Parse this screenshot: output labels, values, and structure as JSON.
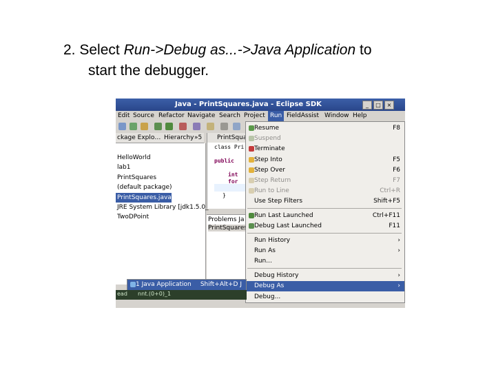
{
  "caption": {
    "line1_prefix": "2. Select ",
    "line1_emph_a": "Run->Debug as...",
    "line1_emph_b": "->Java Application",
    "line1_suffix": " to",
    "line2": "start the debugger."
  },
  "window": {
    "title": "Java - PrintSquares.java - Eclipse SDK",
    "controls": [
      "_",
      "□",
      "×"
    ]
  },
  "menubar": [
    "Edit",
    "Source",
    "Refactor",
    "Navigate",
    "Search",
    "Project",
    "Run",
    "FieldAssist",
    "Window",
    "Help"
  ],
  "left_view": {
    "tabs": [
      "ckage Explo…",
      "Hierarchy",
      "»5"
    ],
    "tree": [
      "HelloWorld",
      "lab1",
      "PrintSquares",
      "(default package)",
      "PrintSquares.java",
      "JRE System Library [jdk1.5.0_",
      "TwoDPoint"
    ]
  },
  "editor": {
    "tab_label": "PrintSqua",
    "code": [
      "class Pri",
      "public",
      "int",
      "for",
      "}"
    ]
  },
  "problems": {
    "tab": "Problems Ja",
    "row": "PrintSquares"
  },
  "run_menu": {
    "items": [
      {
        "label": "Resume",
        "accel": "F8",
        "enabled": true
      },
      {
        "label": "Suspend",
        "accel": "",
        "enabled": false
      },
      {
        "label": "Terminate",
        "accel": "",
        "enabled": true
      },
      {
        "label": "Step Into",
        "accel": "F5",
        "enabled": true
      },
      {
        "label": "Step Over",
        "accel": "F6",
        "enabled": true
      },
      {
        "label": "Step Return",
        "accel": "F7",
        "enabled": false
      },
      {
        "label": "Run to Line",
        "accel": "Ctrl+R",
        "enabled": false
      },
      {
        "label": "Use Step Filters",
        "accel": "Shift+F5",
        "enabled": true
      },
      {
        "label": "Run Last Launched",
        "accel": "Ctrl+F11",
        "enabled": true
      },
      {
        "label": "Debug Last Launched",
        "accel": "F11",
        "enabled": true
      },
      {
        "label": "Run History",
        "accel": "›",
        "enabled": true
      },
      {
        "label": "Run As",
        "accel": "›",
        "enabled": true
      },
      {
        "label": "Run...",
        "accel": "",
        "enabled": true
      },
      {
        "label": "Debug History",
        "accel": "›",
        "enabled": true
      },
      {
        "label": "Debug As",
        "accel": "›",
        "enabled": true
      },
      {
        "label": "Debug...",
        "accel": "",
        "enabled": true
      }
    ]
  },
  "submenu": {
    "label": "1 Java Application",
    "accel": "Shift+Alt+D J"
  },
  "statusbar": {
    "left": "ead",
    "right": "nnt.(0+0)_1"
  },
  "colors": {
    "title_bg": "#2a468a",
    "highlight": "#3a5da6",
    "menu_bg": "#f0eeea",
    "chrome_bg": "#d6d3ce"
  }
}
